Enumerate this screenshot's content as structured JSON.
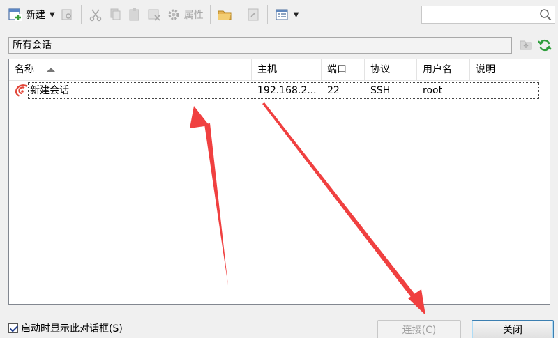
{
  "toolbar": {
    "new_label": "新建",
    "properties_label": "属性"
  },
  "path": {
    "text": "所有会话"
  },
  "list": {
    "columns": [
      "名称",
      "主机",
      "端口",
      "协议",
      "用户名",
      "说明"
    ],
    "rows": [
      {
        "name": "新建会话",
        "host": "192.168.2...",
        "port": "22",
        "protocol": "SSH",
        "user": "root",
        "note": ""
      }
    ]
  },
  "footer": {
    "startup_checkbox_label": "启动时显示此对话框(S)",
    "startup_checked": true,
    "connect_label": "连接(C)",
    "close_label": "关闭"
  },
  "icons": {
    "new": "new-session-icon",
    "dropdown": "dropdown-arrow-icon",
    "search": "search-icon",
    "refresh": "refresh-icon",
    "session": "xshell-session-icon"
  },
  "colors": {
    "annotation_arrow": "#f04040",
    "refresh_green": "#2f9e3c",
    "session_red": "#e2473a"
  }
}
